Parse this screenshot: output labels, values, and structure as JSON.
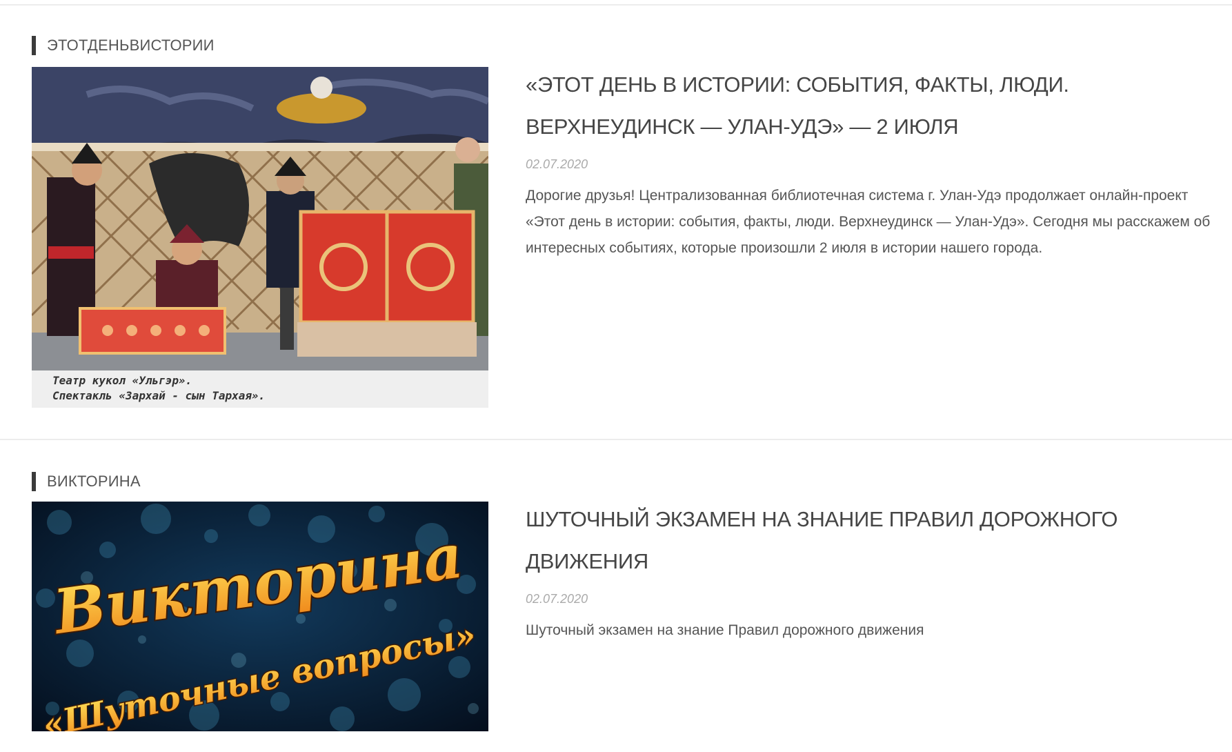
{
  "posts": [
    {
      "category": "ЭТОТДЕНЬВИСТОРИИ",
      "title": "«ЭТОТ ДЕНЬ В ИСТОРИИ: СОБЫТИЯ, ФАКТЫ, ЛЮДИ. ВЕРХНЕУДИНСК — УЛАН-УДЭ» — 2 ИЮЛЯ",
      "date": "02.07.2020",
      "excerpt": "Дорогие друзья! Централизованная библиотечная система г. Улан-Удэ продолжает онлайн-проект «Этот день в истории: события, факты, люди. Верхнеудинск — Улан-Удэ». Сегодня мы расскажем об интересных событиях, которые произошли 2 июля в истории нашего города.",
      "image_caption_line1": "Театр кукол «Ульгэр».",
      "image_caption_line2": "Спектакль «Зархай - сын Тархая»."
    },
    {
      "category": "ВИКТОРИНА",
      "title": "ШУТОЧНЫЙ ЭКЗАМЕН НА ЗНАНИЕ ПРАВИЛ ДОРОЖНОГО ДВИЖЕНИЯ",
      "date": "02.07.2020",
      "excerpt": "Шуточный экзамен на знание Правил дорожного движения",
      "image_text_line1": "Викторина",
      "image_text_line2": "«Шуточные вопросы»"
    }
  ],
  "colors": {
    "category_bar": "#3b3b3b",
    "title": "#454545",
    "date": "#aaaaaa",
    "text": "#555555",
    "quiz_bg": "#07192e",
    "quiz_text_gold": "#f7c62b"
  }
}
